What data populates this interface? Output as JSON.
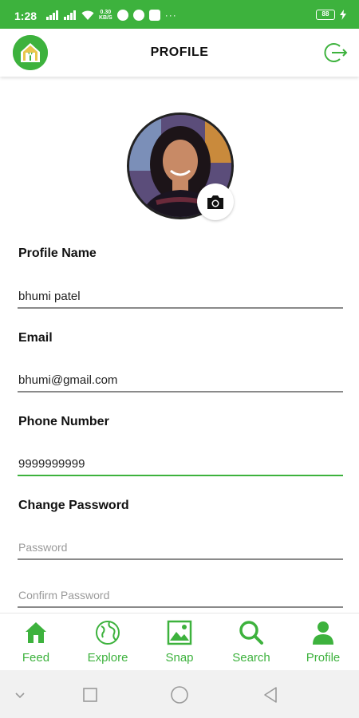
{
  "status_bar": {
    "time": "1:28",
    "speed_value": "0.30",
    "speed_unit": "KB/S",
    "battery": "88",
    "overflow": "···"
  },
  "header": {
    "title": "PROFILE",
    "logo_icon": "house-logo-icon",
    "logout_icon": "logout-icon"
  },
  "avatar": {
    "camera_icon": "camera-icon"
  },
  "form": {
    "profile_name": {
      "label": "Profile Name",
      "value": "bhumi patel"
    },
    "email": {
      "label": "Email",
      "value": "bhumi@gmail.com"
    },
    "phone": {
      "label": "Phone Number",
      "value": "9999999999"
    },
    "change_password": {
      "label": "Change Password"
    },
    "password": {
      "placeholder": "Password"
    },
    "confirm_password": {
      "placeholder": "Confirm Password"
    }
  },
  "bottom_nav": {
    "items": [
      {
        "label": "Feed",
        "icon": "home-icon"
      },
      {
        "label": "Explore",
        "icon": "globe-icon"
      },
      {
        "label": "Snap",
        "icon": "image-icon"
      },
      {
        "label": "Search",
        "icon": "search-icon"
      },
      {
        "label": "Profile",
        "icon": "person-icon"
      }
    ]
  },
  "colors": {
    "accent": "#3db23d",
    "text": "#111111",
    "underline": "#8a8a8a",
    "system_nav_bg": "#f1f1f1"
  }
}
